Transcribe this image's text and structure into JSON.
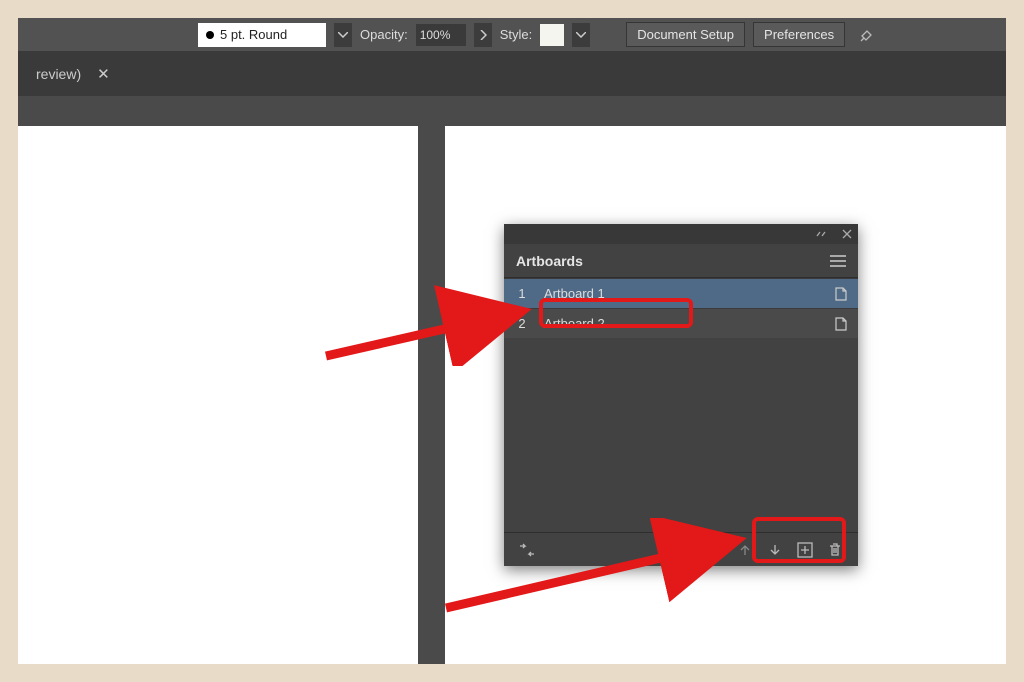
{
  "toolbar": {
    "stroke_label": "5 pt. Round",
    "opacity_label": "Opacity:",
    "opacity_value": "100%",
    "style_label": "Style:",
    "document_setup": "Document Setup",
    "preferences": "Preferences"
  },
  "tab": {
    "label": "review)"
  },
  "panel": {
    "title": "Artboards",
    "items": [
      {
        "num": "1",
        "name": "Artboard 1",
        "selected": true
      },
      {
        "num": "2",
        "name": "Artboard 2",
        "selected": false
      }
    ]
  }
}
